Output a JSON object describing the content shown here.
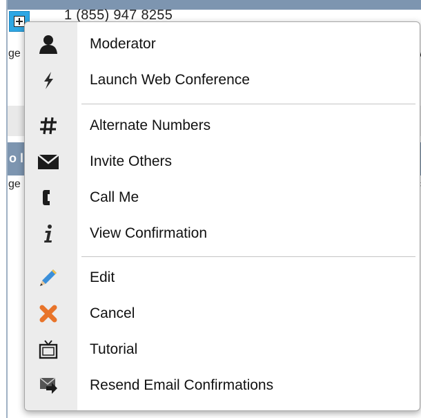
{
  "background": {
    "phone_number": "1 (855) 947 8255",
    "fragment_left_1": "ge",
    "fragment_left_2": "ge",
    "fragment_right_1": "w",
    "fragment_right_2": "c",
    "bar_fragment": "o l"
  },
  "menu": {
    "items": [
      {
        "label": "Moderator",
        "icon": "user-icon"
      },
      {
        "label": "Launch Web Conference",
        "icon": "lightning-icon"
      },
      {
        "label": "Alternate Numbers",
        "icon": "hash-icon"
      },
      {
        "label": "Invite Others",
        "icon": "envelope-icon"
      },
      {
        "label": "Call Me",
        "icon": "phone-icon"
      },
      {
        "label": "View Confirmation",
        "icon": "info-icon"
      },
      {
        "label": "Edit",
        "icon": "pencil-icon"
      },
      {
        "label": "Cancel",
        "icon": "x-icon"
      },
      {
        "label": "Tutorial",
        "icon": "tv-icon"
      },
      {
        "label": "Resend Email Confirmations",
        "icon": "resend-email-icon"
      }
    ]
  },
  "colors": {
    "accent_blue": "#2fa7e4",
    "header_bar": "#7d95b0",
    "menu_gutter": "#ececec",
    "cancel_icon": "#e8742a",
    "edit_icon": "#3b8fd9"
  }
}
